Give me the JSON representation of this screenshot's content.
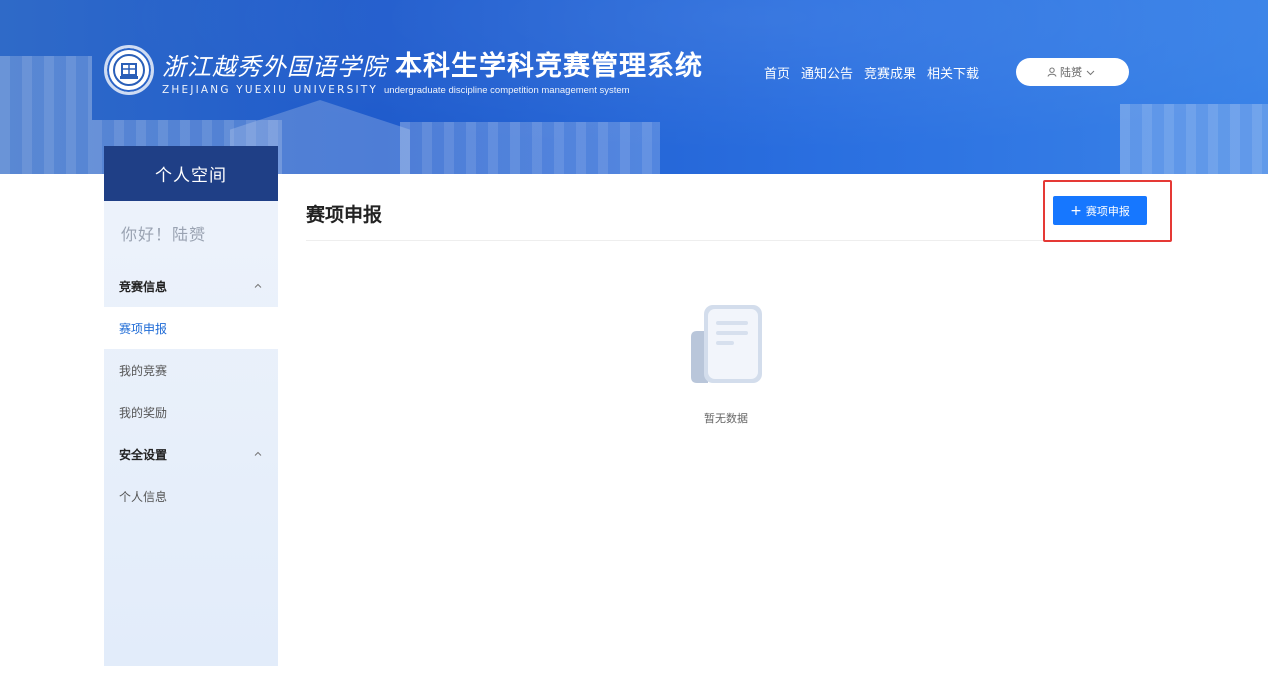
{
  "header": {
    "school_cn": "浙江越秀外国语学院",
    "school_en": "ZHEJIANG YUEXIU UNIVERSITY",
    "system_cn": "本科生学科竞赛管理系统",
    "system_en": "undergraduate discipline competition management system",
    "nav": [
      {
        "label": "首页"
      },
      {
        "label": "通知公告"
      },
      {
        "label": "竞赛成果"
      },
      {
        "label": "相关下载"
      }
    ],
    "user_name": "陆赟"
  },
  "sidebar": {
    "title": "个人空间",
    "greeting": "你好！陆赟",
    "groups": [
      {
        "label": "竞赛信息",
        "items": [
          {
            "label": "赛项申报"
          },
          {
            "label": "我的竞赛"
          },
          {
            "label": "我的奖励"
          }
        ]
      },
      {
        "label": "安全设置",
        "items": [
          {
            "label": "个人信息"
          }
        ]
      }
    ],
    "active_item": "赛项申报"
  },
  "main": {
    "title": "赛项申报",
    "add_button_label": "赛项申报",
    "empty_text": "暂无数据"
  },
  "colors": {
    "banner": "#2a63cc",
    "sidebar_head": "#1f3f86",
    "primary": "#1677ff",
    "active_text": "#1e6bd6",
    "highlight_border": "#e53935"
  }
}
